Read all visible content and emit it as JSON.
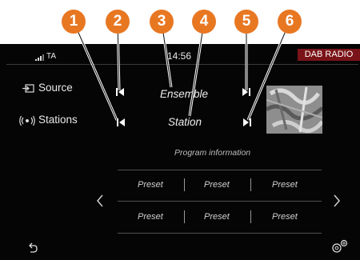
{
  "callouts": [
    "1",
    "2",
    "3",
    "4",
    "5",
    "6"
  ],
  "status": {
    "ta": "TA",
    "time": "14:56",
    "badge": "DAB RADIO"
  },
  "menu": {
    "source": "Source",
    "stations": "Stations"
  },
  "radio": {
    "ensemble": "Ensemble",
    "station": "Station",
    "program_info": "Program information"
  },
  "presets": {
    "row1": [
      "Preset",
      "Preset",
      "Preset"
    ],
    "row2": [
      "Preset",
      "Preset",
      "Preset"
    ]
  },
  "colors": {
    "callout": "#e87722",
    "badge": "#7a1418",
    "screen": "#050505"
  },
  "icons": [
    "signal-icon",
    "source-icon",
    "stations-icon",
    "prev-icon",
    "next-icon",
    "chevron-left-icon",
    "chevron-right-icon",
    "back-icon",
    "settings-icon"
  ]
}
